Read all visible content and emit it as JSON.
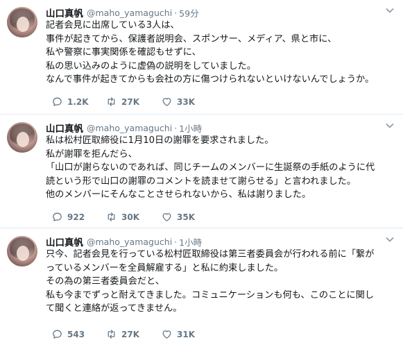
{
  "tweets": [
    {
      "name": "山口真帆",
      "handle": "@maho_yamaguchi",
      "separator": "·",
      "time": "59分",
      "lines": [
        "記者会見に出席している3人は、",
        "事件が起きてから、保護者説明会、スポンサー、メディア、県と市に、",
        "私や警察に事実関係を確認もせずに、",
        "私の思い込みのように虚偽の説明をしていました。",
        "なんで事件が起きてからも会社の方に傷つけられないといけないんでしょうか。"
      ],
      "replies": "1.2K",
      "retweets": "27K",
      "likes": "33K"
    },
    {
      "name": "山口真帆",
      "handle": "@maho_yamaguchi",
      "separator": "·",
      "time": "1小時",
      "lines": [
        "私は松村匠取締役に1月10日の謝罪を要求されました。",
        "私が謝罪を拒んだら、",
        "「山口が謝らないのであれば、同じチームのメンバーに生誕祭の手紙のように代",
        "読という形で山口の謝罪のコメントを読ませて謝らせる」と言われました。",
        "他のメンバーにそんなことさせられないから、私は謝りました。"
      ],
      "replies": "922",
      "retweets": "30K",
      "likes": "35K"
    },
    {
      "name": "山口真帆",
      "handle": "@maho_yamaguchi",
      "separator": "·",
      "time": "1小時",
      "lines": [
        "只今、記者会見を行っている松村匠取締役は第三者委員会が行われる前に「繋が",
        "っているメンバーを全員解雇する」と私に約束しました。",
        "その為の第三者委員会だと、",
        "私も今までずっと耐えてきました。コミュニケーションも何も、このことに関し",
        "て聞くと連絡が返ってきません。"
      ],
      "replies": "543",
      "retweets": "27K",
      "likes": "31K"
    }
  ],
  "icons": {
    "reply": "speech-bubble-icon",
    "retweet": "retweet-arrows-icon",
    "like": "heart-icon",
    "more": "chevron-down-icon"
  },
  "colors": {
    "text": "#14171a",
    "secondary": "#657786",
    "border": "#e1e8ed"
  }
}
